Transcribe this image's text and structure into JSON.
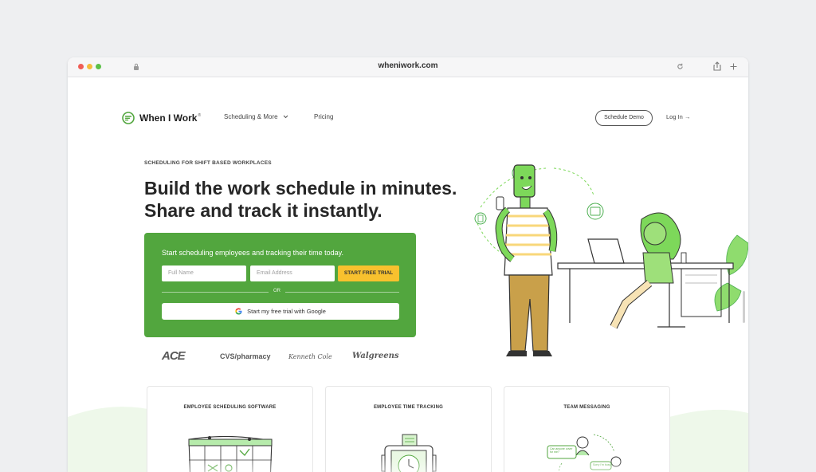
{
  "browser": {
    "url": "wheniwork.com",
    "icons": [
      "lock-icon",
      "reload-icon",
      "share-icon",
      "new-tab-icon"
    ]
  },
  "nav": {
    "logo_text": "When I Work",
    "logo_mark": "®",
    "scheduling_label": "Scheduling & More",
    "pricing_label": "Pricing",
    "demo_label": "Schedule Demo",
    "login_label": "Log In",
    "login_arrow": "→"
  },
  "hero": {
    "eyebrow": "SCHEDULING FOR SHIFT BASED WORKPLACES",
    "headline_line1": "Build the work schedule in minutes.",
    "headline_line2": "Share and track it instantly."
  },
  "signup": {
    "subtitle": "Start scheduling employees and tracking their time today.",
    "name_placeholder": "Full Name",
    "email_placeholder": "Email Address",
    "trial_button": "START FREE TRIAL",
    "or_text": "OR",
    "google_button": "Start my free trial with Google"
  },
  "brands": [
    "ACE",
    "CVS/pharmacy",
    "Kenneth Cole",
    "Walgreens"
  ],
  "features": [
    {
      "title": "EMPLOYEE SCHEDULING SOFTWARE"
    },
    {
      "title": "EMPLOYEE TIME TRACKING"
    },
    {
      "title": "TEAM MESSAGING"
    }
  ],
  "messaging_bubbles": [
    "Can anyone cover for me?",
    "Sorry I'm busy"
  ],
  "colors": {
    "brand_green": "#52a63e",
    "accent_yellow": "#f8c12e",
    "illustration_green": "#7dd85a",
    "background_gray": "#eeeff1"
  }
}
